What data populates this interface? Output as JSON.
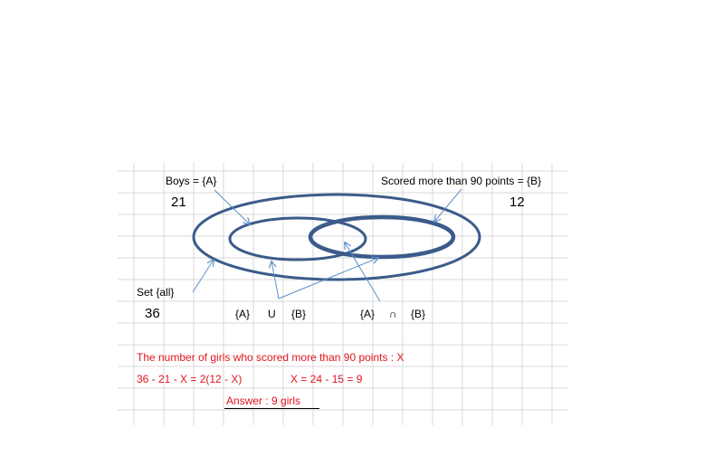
{
  "labels": {
    "boys": "Boys = {A}",
    "boys_count": "21",
    "scored": "Scored more than 90 points = {B}",
    "scored_count": "12",
    "set_all": "Set {all}",
    "set_all_count": "36",
    "union": {
      "a": "{A}",
      "op": "U",
      "b": "{B}"
    },
    "intersection": {
      "a": "{A}",
      "op": "∩",
      "b": "{B}"
    }
  },
  "solution": {
    "line1": "The number of girls who scored more than 90 points : X",
    "line2a": "36 - 21 - X = 2(12 - X)",
    "line2b": "X = 24 - 15 = 9",
    "answer": "Answer : 9 girls"
  },
  "colors": {
    "ellipse": "#3b5b8a",
    "arrow": "#5b8fc9",
    "grid": "#d9d9d9",
    "text": "#000000",
    "solution_text": "#e0141e"
  }
}
